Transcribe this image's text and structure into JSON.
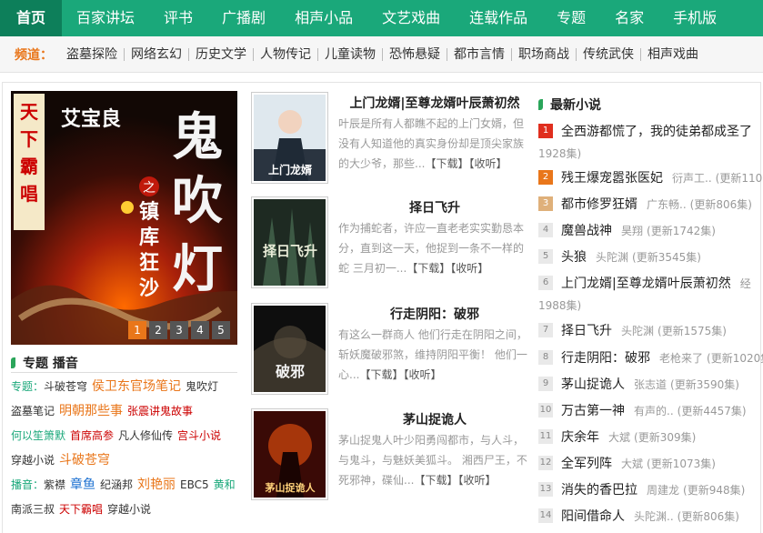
{
  "nav": [
    {
      "label": "首页"
    },
    {
      "label": "百家讲坛"
    },
    {
      "label": "评书"
    },
    {
      "label": "广播剧"
    },
    {
      "label": "相声小品"
    },
    {
      "label": "文艺戏曲"
    },
    {
      "label": "连载作品"
    },
    {
      "label": "专题"
    },
    {
      "label": "名家"
    },
    {
      "label": "手机版"
    }
  ],
  "channels": {
    "label": "频道：",
    "items": [
      "盗墓探险",
      "网络玄幻",
      "历史文学",
      "人物传记",
      "儿童读物",
      "恐怖悬疑",
      "都市言情",
      "职场商战",
      "传统武侠",
      "相声戏曲"
    ]
  },
  "banner": {
    "side_text": "天下霸唱",
    "author": "艾宝良",
    "title_main": "鬼吹灯",
    "subtitle": "之镇库狂沙",
    "pages": [
      "1",
      "2",
      "3",
      "4",
      "5"
    ]
  },
  "zhuanti": {
    "title": "专题 播音",
    "line1": {
      "label": "专题：",
      "items": [
        "斗破苍穹",
        "侯卫东官场笔记",
        "鬼吹灯",
        "盗墓笔记",
        "明朝那些事",
        "张震讲鬼故事",
        "何以笙箫默",
        "首席高参",
        "凡人修仙传",
        "宫斗小说",
        "穿越小说",
        "斗破苍穹"
      ]
    },
    "line2": {
      "label": "播音：",
      "items": [
        "紫襟",
        "章鱼",
        "纪涵邦",
        "刘艳丽",
        "EBC5",
        "黄和",
        "南派三叔",
        "天下霸唱",
        "穿越小说"
      ]
    }
  },
  "books": [
    {
      "title": "上门龙婿|至尊龙婿叶辰萧初然",
      "desc": "叶辰是所有人都瞧不起的上门女婿，但没有人知道他的真实身份却是顶尖家族的大少爷，那些...",
      "download": "【下载】",
      "favorite": "【收听】",
      "cover_text": "上门龙婿"
    },
    {
      "title": "择日飞升",
      "desc": "作为捕蛇者，许应一直老老实实勤恳本分，直到这一天，他捉到一条不一样的蛇 三月初一...",
      "download": "【下载】",
      "favorite": "【收听】",
      "cover_text": "择日飞升"
    },
    {
      "title": "行走阴阳：破邪",
      "desc": "有这么一群商人 他们行走在阴阳之间，斩妖魔破邪煞，维持阴阳平衡！ 他们一心...",
      "download": "【下载】",
      "favorite": "【收听】",
      "cover_text": "破邪"
    },
    {
      "title": "茅山捉诡人",
      "desc": "茅山捉鬼人叶少阳勇闯都市，与人斗，与鬼斗，与魅妖美狐斗。 湘西尸王，不死邪神，碟仙...",
      "download": "【下载】",
      "favorite": "【收听】",
      "cover_text": "茅山捉诡人"
    }
  ],
  "latest": {
    "title": "最新小说",
    "items": [
      {
        "n": "1",
        "title": "全西游都慌了，我的徒弟都成圣了",
        "author": "",
        "count": "",
        "wrap": "1928集)"
      },
      {
        "n": "2",
        "title": "残王爆宠嚣张医妃",
        "author": "衍声工..",
        "count": "(更新110",
        "wrap": ""
      },
      {
        "n": "3",
        "title": "都市修罗狂婿",
        "author": "广东畅..",
        "count": "(更新806集)",
        "wrap": ""
      },
      {
        "n": "4",
        "title": "魔兽战神",
        "author": "昊翔",
        "count": "(更新1742集)",
        "wrap": ""
      },
      {
        "n": "5",
        "title": "头狼",
        "author": "头陀渊",
        "count": "(更新3545集)",
        "wrap": ""
      },
      {
        "n": "6",
        "title": "上门龙婿|至尊龙婿叶辰萧初然",
        "author": "经",
        "count": "",
        "wrap": "1988集)"
      },
      {
        "n": "7",
        "title": "择日飞升",
        "author": "头陀渊",
        "count": "(更新1575集)",
        "wrap": ""
      },
      {
        "n": "8",
        "title": "行走阴阳：破邪",
        "author": "老枪来了",
        "count": "(更新1020集",
        "wrap": ""
      },
      {
        "n": "9",
        "title": "茅山捉诡人",
        "author": "张志道",
        "count": "(更新3590集)",
        "wrap": ""
      },
      {
        "n": "10",
        "title": "万古第一神",
        "author": "有声的..",
        "count": "(更新4457集)",
        "wrap": ""
      },
      {
        "n": "11",
        "title": "庆余年",
        "author": "大斌",
        "count": "(更新309集)",
        "wrap": ""
      },
      {
        "n": "12",
        "title": "全军列阵",
        "author": "大斌",
        "count": "(更新1073集)",
        "wrap": ""
      },
      {
        "n": "13",
        "title": "消失的香巴拉",
        "author": "周建龙",
        "count": "(更新948集)",
        "wrap": ""
      },
      {
        "n": "14",
        "title": "阳间借命人",
        "author": "头陀渊..",
        "count": "(更新806集)",
        "wrap": ""
      }
    ]
  },
  "colors": {
    "brand": "#1aa87a",
    "brand_dark": "#0d7f5a",
    "accent": "#e9761a",
    "red": "#e02e1e"
  }
}
